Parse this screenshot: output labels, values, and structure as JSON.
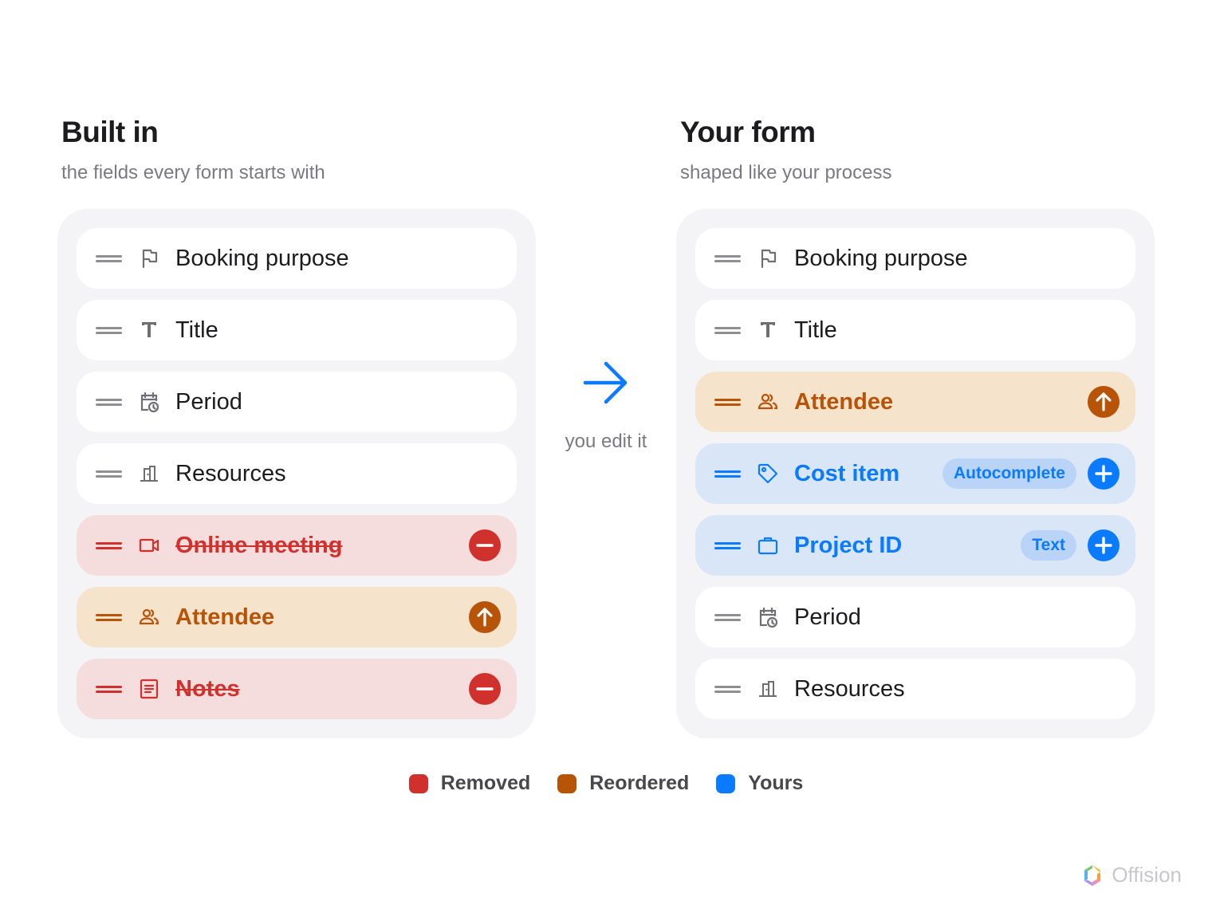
{
  "left": {
    "title": "Built in",
    "subtitle": "the fields every form starts with",
    "fields": [
      {
        "label": "Booking purpose",
        "icon": "flag-icon",
        "state": "normal"
      },
      {
        "label": "Title",
        "icon": "text-icon",
        "state": "normal"
      },
      {
        "label": "Period",
        "icon": "calendar-clock-icon",
        "state": "normal"
      },
      {
        "label": "Resources",
        "icon": "door-icon",
        "state": "normal"
      },
      {
        "label": "Online meeting",
        "icon": "video-icon",
        "state": "removed",
        "action": "minus-icon"
      },
      {
        "label": "Attendee",
        "icon": "people-icon",
        "state": "reordered",
        "action": "arrow-up-icon"
      },
      {
        "label": "Notes",
        "icon": "document-icon",
        "state": "removed",
        "action": "minus-icon"
      }
    ]
  },
  "middle": {
    "arrow_icon": "arrow-right-icon",
    "caption": "you edit it"
  },
  "right": {
    "title": "Your form",
    "subtitle": "shaped like your process",
    "fields": [
      {
        "label": "Booking purpose",
        "icon": "flag-icon",
        "state": "normal"
      },
      {
        "label": "Title",
        "icon": "text-icon",
        "state": "normal"
      },
      {
        "label": "Attendee",
        "icon": "people-icon",
        "state": "reordered",
        "action": "arrow-up-icon"
      },
      {
        "label": "Cost item",
        "icon": "tag-icon",
        "state": "yours",
        "type_label": "Autocomplete",
        "action": "plus-icon"
      },
      {
        "label": "Project ID",
        "icon": "briefcase-icon",
        "state": "yours",
        "type_label": "Text",
        "action": "plus-icon"
      },
      {
        "label": "Period",
        "icon": "calendar-clock-icon",
        "state": "normal"
      },
      {
        "label": "Resources",
        "icon": "door-icon",
        "state": "normal"
      }
    ]
  },
  "legend": [
    {
      "label": "Removed",
      "color": "#d0312d"
    },
    {
      "label": "Reordered",
      "color": "#b85407"
    },
    {
      "label": "Yours",
      "color": "#0a7aff"
    }
  ],
  "brand": {
    "name": "Offision",
    "logo_icon": "offision-logo-icon"
  },
  "colors": {
    "removed": "#d0312d",
    "reordered": "#b85407",
    "yours": "#0a7aff",
    "normal_handle": "#8e8e93"
  }
}
